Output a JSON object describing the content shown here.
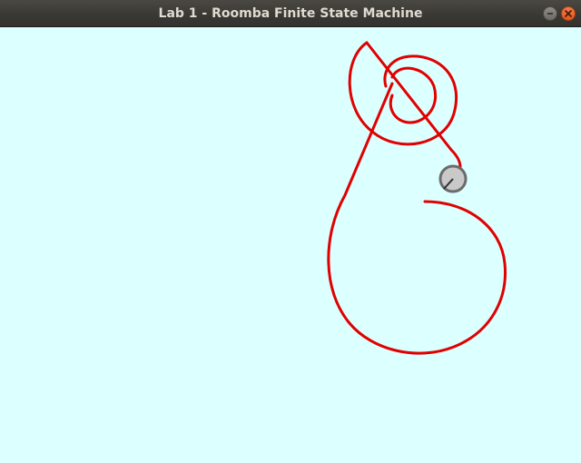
{
  "window": {
    "title": "Lab 1 - Roomba Finite State Machine",
    "minimize_icon": "minimize-icon",
    "close_icon": "close-icon"
  },
  "canvas": {
    "background_color": "#dcffff",
    "path_color": "#e00000",
    "robot_fill_color": "#c9c9c9",
    "robot_outline_color": "#6b6b6b"
  }
}
